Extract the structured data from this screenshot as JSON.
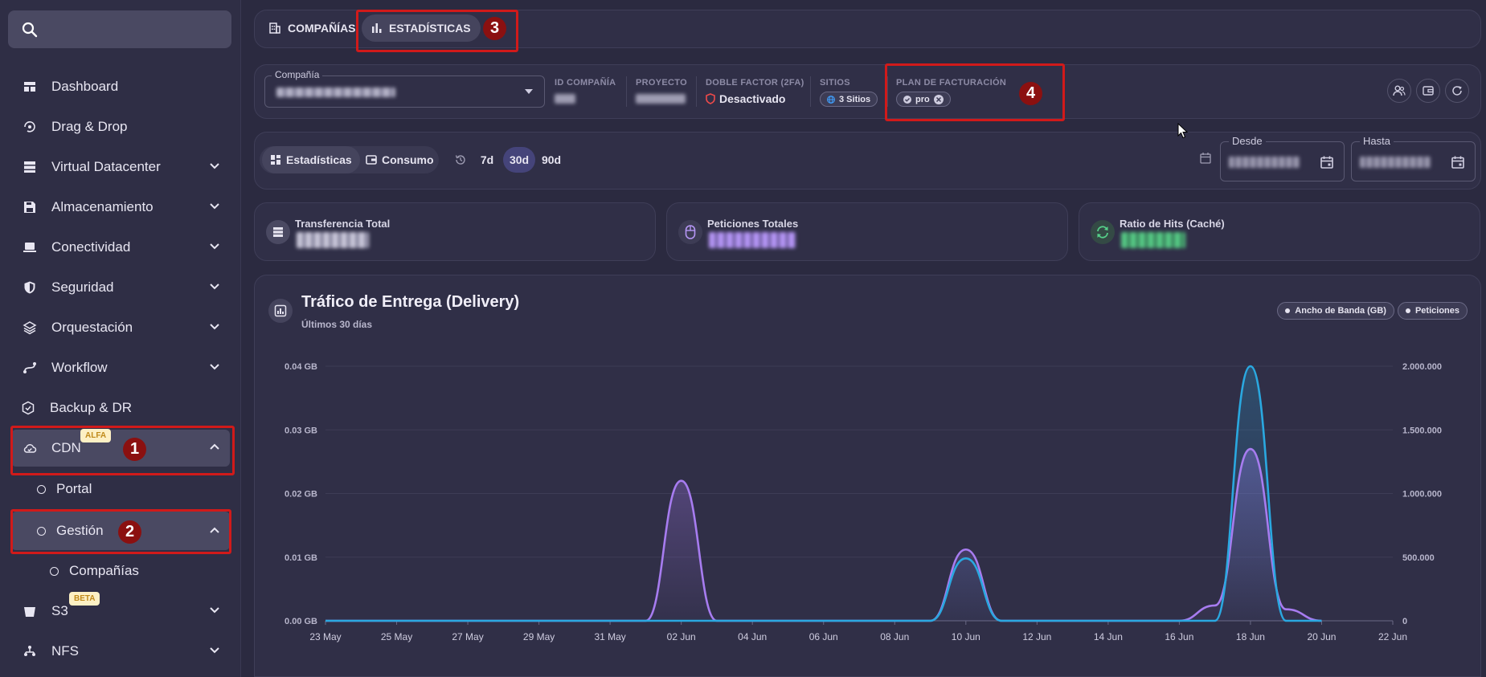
{
  "sidebar": {
    "search_placeholder": "",
    "items": [
      {
        "label": "Dashboard",
        "icon": "dashboard-icon",
        "expandable": false
      },
      {
        "label": "Drag & Drop",
        "icon": "drag-drop-icon",
        "expandable": false
      },
      {
        "label": "Virtual Datacenter",
        "icon": "server-icon",
        "expandable": true
      },
      {
        "label": "Almacenamiento",
        "icon": "save-icon",
        "expandable": true
      },
      {
        "label": "Conectividad",
        "icon": "laptop-icon",
        "expandable": true
      },
      {
        "label": "Seguridad",
        "icon": "shield-icon",
        "expandable": true
      },
      {
        "label": "Orquestación",
        "icon": "layers-icon",
        "expandable": true
      },
      {
        "label": "Workflow",
        "icon": "workflow-icon",
        "expandable": true
      },
      {
        "label": "Backup & DR",
        "icon": "backup-icon",
        "expandable": false
      },
      {
        "label": "CDN",
        "icon": "cloud-icon",
        "expandable": true,
        "badge": "ALFA"
      },
      {
        "label": "S3",
        "icon": "bucket-icon",
        "expandable": true,
        "badge": "BETA"
      },
      {
        "label": "NFS",
        "icon": "nfs-icon",
        "expandable": true
      }
    ],
    "cdn_children": {
      "portal": "Portal",
      "gestion": "Gestión",
      "companias": "Compañías"
    }
  },
  "annotations": [
    "1",
    "2",
    "3",
    "4"
  ],
  "tabs": {
    "companias": "COMPAÑÍAS",
    "estadisticas": "ESTADÍSTICAS"
  },
  "info_bar": {
    "company_label": "Compañía",
    "id_label": "ID COMPAÑÍA",
    "project_label": "PROYECTO",
    "twofa_label": "DOBLE FACTOR (2FA)",
    "twofa_value": "Desactivado",
    "sites_label": "SITIOS",
    "sites_value": "3 Sitios",
    "billing_label": "PLAN DE FACTURACIÓN",
    "billing_value": "pro"
  },
  "toolbar": {
    "estadisticas": "Estadísticas",
    "consumo": "Consumo",
    "ranges": [
      "7d",
      "30d",
      "90d"
    ],
    "active_range": "30d",
    "from_label": "Desde",
    "to_label": "Hasta"
  },
  "stats": {
    "transfer_title": "Transferencia Total",
    "requests_title": "Peticiones Totales",
    "hits_title": "Ratio de Hits (Caché)"
  },
  "chart_panel": {
    "title": "Tráfico de Entrega (Delivery)",
    "subtitle": "Últimos 30 días",
    "legend": [
      "Ancho de Banda (GB)",
      "Peticiones"
    ]
  },
  "colors": {
    "bandwidth": "#2aa8e0",
    "requests": "#a77cf0",
    "accent": "#45447a",
    "annotation": "#d11a1a"
  },
  "chart_data": {
    "type": "area",
    "x_ticks": [
      "23 May",
      "25 May",
      "27 May",
      "29 May",
      "31 May",
      "02 Jun",
      "04 Jun",
      "06 Jun",
      "08 Jun",
      "10 Jun",
      "12 Jun",
      "14 Jun",
      "16 Jun",
      "18 Jun",
      "20 Jun",
      "22 Jun"
    ],
    "y_left_ticks": [
      "0.00 GB",
      "0.01 GB",
      "0.02 GB",
      "0.03 GB",
      "0.04 GB"
    ],
    "y_right_ticks": [
      "0",
      "500.000",
      "1.000.000",
      "1.500.000",
      "2.000.000"
    ],
    "ylim_left": [
      0,
      0.04
    ],
    "ylim_right": [
      0,
      2000000
    ],
    "grid": true,
    "x": [
      "23 May",
      "24 May",
      "25 May",
      "26 May",
      "27 May",
      "28 May",
      "29 May",
      "30 May",
      "31 May",
      "01 Jun",
      "02 Jun",
      "03 Jun",
      "04 Jun",
      "05 Jun",
      "06 Jun",
      "07 Jun",
      "08 Jun",
      "09 Jun",
      "10 Jun",
      "11 Jun",
      "12 Jun",
      "13 Jun",
      "14 Jun",
      "15 Jun",
      "16 Jun",
      "17 Jun",
      "18 Jun",
      "19 Jun",
      "20 Jun"
    ],
    "series": [
      {
        "name": "Ancho de Banda (GB)",
        "axis": "left",
        "values": [
          0,
          0,
          0,
          0,
          0,
          0,
          0,
          0,
          0,
          0,
          0,
          0,
          0,
          0,
          0,
          0,
          0,
          0,
          0.0098,
          0,
          0,
          0,
          0,
          0,
          0,
          0,
          0.04,
          0,
          0
        ]
      },
      {
        "name": "Peticiones",
        "axis": "right",
        "values": [
          0,
          0,
          0,
          0,
          0,
          0,
          0,
          0,
          0,
          0,
          1100000,
          0,
          0,
          0,
          0,
          0,
          0,
          0,
          560000,
          0,
          0,
          0,
          0,
          0,
          0,
          120000,
          1350000,
          90000,
          0
        ]
      }
    ]
  }
}
